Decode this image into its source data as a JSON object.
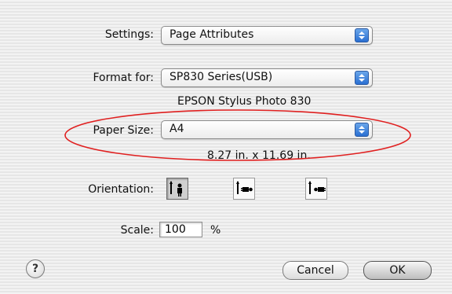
{
  "settings": {
    "label": "Settings:",
    "value": "Page Attributes"
  },
  "format_for": {
    "label": "Format for:",
    "value": "SP830 Series(USB)",
    "printer_name": "EPSON Stylus Photo 830"
  },
  "paper_size": {
    "label": "Paper Size:",
    "value": "A4",
    "dimensions": "8.27 in. x 11.69 in."
  },
  "orientation": {
    "label": "Orientation:",
    "options": [
      {
        "name": "portrait",
        "selected": true
      },
      {
        "name": "landscape-left",
        "selected": false
      },
      {
        "name": "landscape-right",
        "selected": false
      }
    ]
  },
  "scale": {
    "label": "Scale:",
    "value": "100",
    "unit": "%"
  },
  "buttons": {
    "help": "?",
    "cancel": "Cancel",
    "ok": "OK"
  },
  "annotation": {
    "color": "#e02020"
  }
}
